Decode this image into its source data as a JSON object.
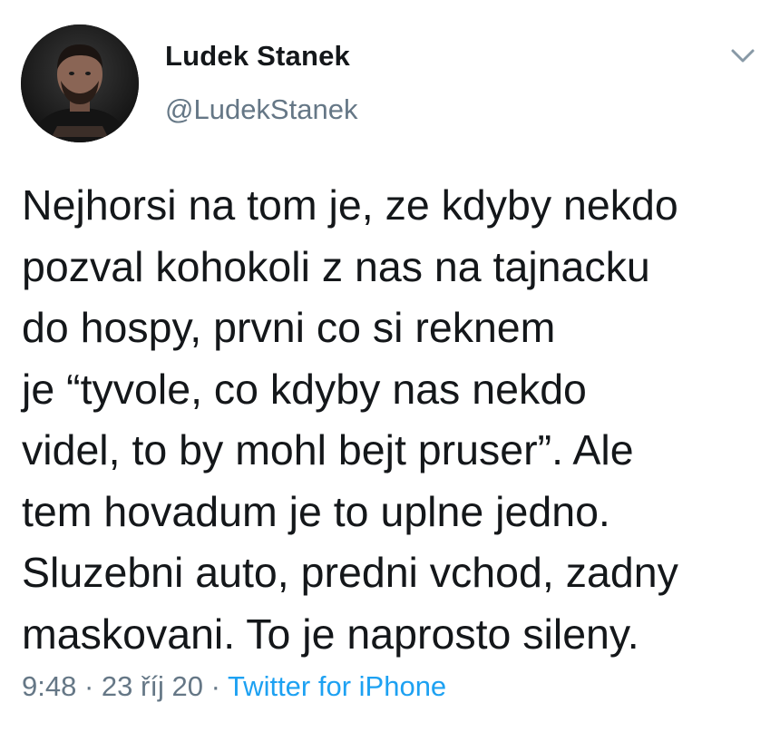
{
  "author": {
    "display_name": "Ludek Stanek",
    "handle": "@LudekStanek"
  },
  "tweet": {
    "lines": [
      "Nejhorsi na tom je, ze kdyby nekdo",
      "pozval kohokoli z nas na tajnacku",
      "do hospy, prvni co si reknem",
      "je “tyvole, co kdyby nas nekdo",
      "videl, to by mohl bejt pruser”. Ale",
      "tem hovadum je to uplne jedno.",
      "Sluzebni auto, predni vchod, zadny",
      "maskovani. To je naprosto sileny."
    ]
  },
  "meta": {
    "time": "9:48",
    "separator": "·",
    "date": "23 říj 20",
    "source": "Twitter for iPhone"
  },
  "icons": {
    "menu": "chevron-down-icon",
    "avatar": "avatar"
  },
  "colors": {
    "text": "#14171a",
    "secondary": "#657786",
    "link": "#1da1f2"
  }
}
